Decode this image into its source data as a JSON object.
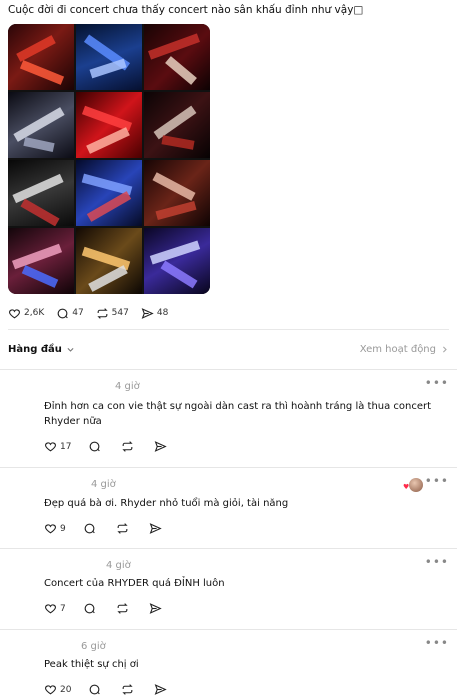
{
  "post": {
    "caption": "Cuộc đời đi concert chưa thấy concert nào sân khấu đỉnh như vậy□",
    "likes": "2,6K",
    "comments": "47",
    "reposts": "547",
    "shares": "48"
  },
  "replies_header": {
    "sort_label": "Hàng đầu",
    "activity_label": "Xem hoạt động"
  },
  "comments": [
    {
      "time": "4 giờ",
      "text": "Đỉnh hơn ca con vie thật sự ngoài dàn cast ra thì hoành tráng là thua concert Rhyder nữa",
      "likes": "17"
    },
    {
      "time": "4 giờ",
      "text": "Đẹp quá bà ơi. Rhyder nhỏ tuổi mà giỏi, tài năng",
      "likes": "9"
    },
    {
      "time": "4 giờ",
      "text": "Concert của RHYDER quá ĐỈNH luôn",
      "likes": "7"
    },
    {
      "time": "6 giờ",
      "text": "Peak thiệt sự chị ơi",
      "likes": "20"
    }
  ],
  "colors": {
    "accent_red": "#ff2a4a",
    "muted": "#999999"
  }
}
